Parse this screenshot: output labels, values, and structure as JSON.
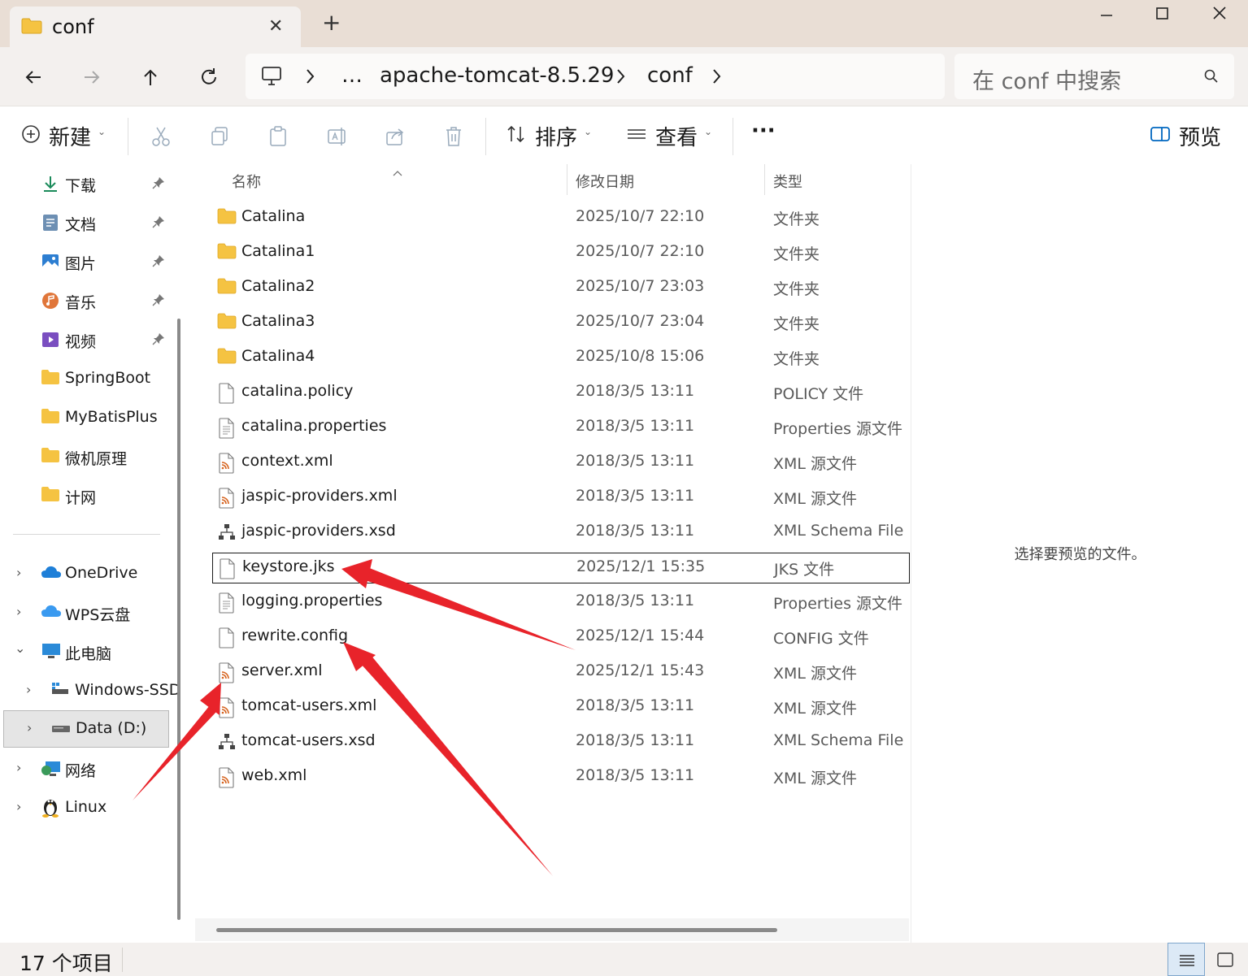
{
  "window": {
    "tab_title": "conf",
    "tab_close": "✕",
    "new_tab": "+"
  },
  "nav": {
    "breadcrumb": [
      "…",
      "apache-tomcat-8.5.29",
      "conf"
    ],
    "search_placeholder": "在 conf 中搜索"
  },
  "toolbar": {
    "new_label": "新建",
    "sort_label": "排序",
    "view_label": "查看",
    "more_label": "···",
    "preview_label": "预览"
  },
  "sidebar": {
    "quick_access": [
      {
        "label": "下载",
        "icon": "download-icon",
        "pinned": true
      },
      {
        "label": "文档",
        "icon": "document-icon",
        "pinned": true
      },
      {
        "label": "图片",
        "icon": "pictures-icon",
        "pinned": true
      },
      {
        "label": "音乐",
        "icon": "music-icon",
        "pinned": true
      },
      {
        "label": "视频",
        "icon": "video-icon",
        "pinned": true
      },
      {
        "label": "SpringBoot",
        "icon": "folder-icon",
        "pinned": false
      },
      {
        "label": "MyBatisPlus",
        "icon": "folder-icon",
        "pinned": false
      },
      {
        "label": "微机原理",
        "icon": "folder-icon",
        "pinned": false
      },
      {
        "label": "计网",
        "icon": "folder-icon",
        "pinned": false
      }
    ],
    "tree": [
      {
        "label": "OneDrive",
        "icon": "onedrive-icon",
        "expanded": false
      },
      {
        "label": "WPS云盘",
        "icon": "cloud-icon",
        "expanded": false
      },
      {
        "label": "此电脑",
        "icon": "pc-icon",
        "expanded": true
      },
      {
        "label": "Windows-SSD",
        "icon": "drive-c-icon",
        "expanded": false
      },
      {
        "label": "Data (D:)",
        "icon": "drive-icon",
        "expanded": false,
        "selected": true
      },
      {
        "label": "网络",
        "icon": "network-icon",
        "expanded": false
      },
      {
        "label": "Linux",
        "icon": "linux-icon",
        "expanded": false
      }
    ]
  },
  "columns": {
    "name": "名称",
    "date": "修改日期",
    "type": "类型"
  },
  "files": [
    {
      "name": "Catalina",
      "date": "2025/10/7 22:10",
      "type": "文件夹",
      "kind": "folder"
    },
    {
      "name": "Catalina1",
      "date": "2025/10/7 22:10",
      "type": "文件夹",
      "kind": "folder"
    },
    {
      "name": "Catalina2",
      "date": "2025/10/7 23:03",
      "type": "文件夹",
      "kind": "folder"
    },
    {
      "name": "Catalina3",
      "date": "2025/10/7 23:04",
      "type": "文件夹",
      "kind": "folder"
    },
    {
      "name": "Catalina4",
      "date": "2025/10/8 15:06",
      "type": "文件夹",
      "kind": "folder"
    },
    {
      "name": "catalina.policy",
      "date": "2018/3/5 13:11",
      "type": "POLICY 文件",
      "kind": "file"
    },
    {
      "name": "catalina.properties",
      "date": "2018/3/5 13:11",
      "type": "Properties 源文件",
      "kind": "text"
    },
    {
      "name": "context.xml",
      "date": "2018/3/5 13:11",
      "type": "XML 源文件",
      "kind": "xml"
    },
    {
      "name": "jaspic-providers.xml",
      "date": "2018/3/5 13:11",
      "type": "XML 源文件",
      "kind": "xml"
    },
    {
      "name": "jaspic-providers.xsd",
      "date": "2018/3/5 13:11",
      "type": "XML Schema File",
      "kind": "xsd"
    },
    {
      "name": "keystore.jks",
      "date": "2025/12/1 15:35",
      "type": "JKS 文件",
      "kind": "file",
      "focused": true
    },
    {
      "name": "logging.properties",
      "date": "2018/3/5 13:11",
      "type": "Properties 源文件",
      "kind": "text"
    },
    {
      "name": "rewrite.config",
      "date": "2025/12/1 15:44",
      "type": "CONFIG 文件",
      "kind": "file"
    },
    {
      "name": "server.xml",
      "date": "2025/12/1 15:43",
      "type": "XML 源文件",
      "kind": "xml"
    },
    {
      "name": "tomcat-users.xml",
      "date": "2018/3/5 13:11",
      "type": "XML 源文件",
      "kind": "xml"
    },
    {
      "name": "tomcat-users.xsd",
      "date": "2018/3/5 13:11",
      "type": "XML Schema File",
      "kind": "xsd"
    },
    {
      "name": "web.xml",
      "date": "2018/3/5 13:11",
      "type": "XML 源文件",
      "kind": "xml"
    }
  ],
  "preview": {
    "empty_message": "选择要预览的文件。"
  },
  "status": {
    "item_count": "17 个项目"
  },
  "colors": {
    "accent": "#0067c0",
    "annotation_arrow": "#e8232a",
    "folder": "#f5c342"
  }
}
